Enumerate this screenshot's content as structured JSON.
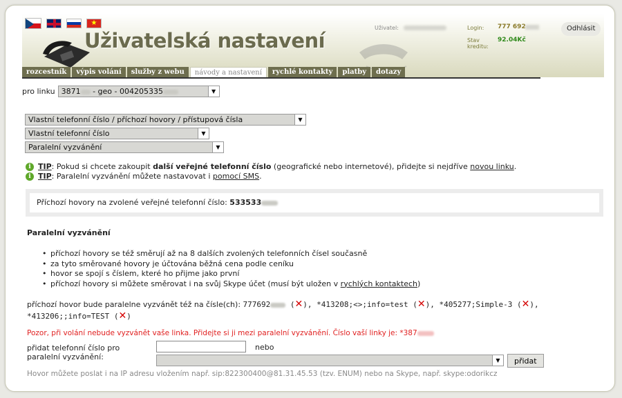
{
  "header": {
    "title": "Uživatelská nastavení",
    "user_label": "Uživatel:",
    "login_label": "Login:",
    "login_value": "777 692",
    "credit_label": "Stav kreditu:",
    "credit_value": "92.04Kč",
    "logout": "Odhlásit",
    "flags": [
      "cz-flag",
      "gb-flag",
      "ru-flag",
      "vn-flag"
    ]
  },
  "tabs": [
    {
      "label": "rozcestník",
      "active": false
    },
    {
      "label": "výpis volání",
      "active": false
    },
    {
      "label": "služby z webu",
      "active": false
    },
    {
      "label": "návody a nastavení",
      "active": true
    },
    {
      "label": "rychlé kontakty",
      "active": false
    },
    {
      "label": "platby",
      "active": false
    },
    {
      "label": "dotazy",
      "active": false
    }
  ],
  "line": {
    "label": "pro linku",
    "value_prefix": "3871",
    "value_mid": " - geo - 004205335"
  },
  "selects": [
    "Vlastní telefonní číslo / příchozí hovory / přístupová čísla",
    "Vlastní telefonní číslo",
    "Paralelní vyzvánění"
  ],
  "tips": {
    "tip_word": "TIP",
    "tip1_a": ": Pokud si chcete zakoupit ",
    "tip1_bold": "další veřejné telefonní číslo",
    "tip1_b": " (geografické nebo internetové), přidejte si nejdříve ",
    "tip1_link": "novou linku",
    "tip1_c": ".",
    "tip2_a": ": Paralelní vyzvánění můžete nastavovat i ",
    "tip2_link": "pomocí SMS",
    "tip2_c": "."
  },
  "incoming": {
    "text": "Příchozí hovory na zvolené veřejné telefonní číslo: ",
    "number": "533533"
  },
  "section_title": "Paralelní vyzvánění",
  "bullets": {
    "b1": "příchozí hovory se též směrují až na 8 dalších zvolených telefonních čísel současně",
    "b2": "za tyto směrované hovory je účtována běžná cena podle ceníku",
    "b3": "hovor se spojí s číslem, které ho přijme jako první",
    "b4_a": "příchozí hovory si můžete směrovat i na svůj Skype účet (musí být uložen v ",
    "b4_link": "rychlých kontaktech",
    "b4_c": ")"
  },
  "paralel": {
    "prefix": "příchozí hovor bude paralelne vyzvánět též na čísle(ch): ",
    "n1": "777692",
    "n2": "*413208;<>;info=test",
    "n3": "*405277;Simple-3",
    "n4": "*413206;;info=TEST"
  },
  "warning": "Pozor, při volání nebude vyzvánět vaše linka. Přidejte si ji mezi paralelní vyzvánění. Číslo vaší linky je: *387",
  "add": {
    "label": "přidat telefonní číslo pro paralelní vyzvánění:",
    "input_value": "",
    "nebo": "nebo",
    "button": "přidat"
  },
  "note": "Hovor můžete poslat i na IP adresu vložením např. sip:822300400@81.31.45.53 (tzv. ENUM) nebo na Skype, např. skype:odorikcz"
}
